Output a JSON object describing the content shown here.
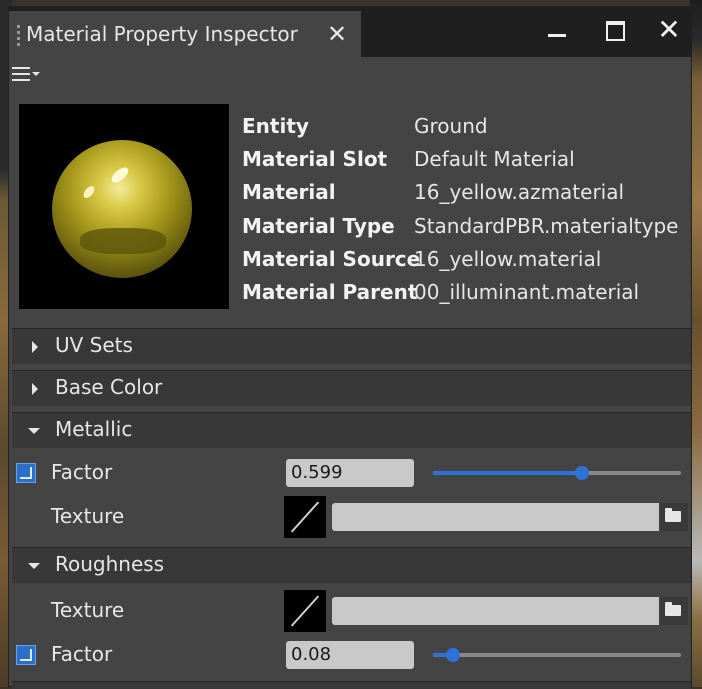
{
  "window": {
    "title": "Material Property Inspector"
  },
  "info": [
    {
      "key": "Entity",
      "value": "Ground"
    },
    {
      "key": "Material Slot",
      "value": "Default Material"
    },
    {
      "key": "Material",
      "value": "16_yellow.azmaterial"
    },
    {
      "key": "Material Type",
      "value": "StandardPBR.materialtype"
    },
    {
      "key": "Material Source",
      "value": "16_yellow.material"
    },
    {
      "key": "Material Parent",
      "value": "00_illuminant.material"
    }
  ],
  "sections": {
    "uv_sets": {
      "label": "UV Sets",
      "expanded": false
    },
    "base_color": {
      "label": "Base Color",
      "expanded": false
    },
    "metallic": {
      "label": "Metallic",
      "expanded": true,
      "factor": {
        "label": "Factor",
        "value": "0.599",
        "slider": 0.599
      },
      "texture": {
        "label": "Texture",
        "path": ""
      }
    },
    "roughness": {
      "label": "Roughness",
      "expanded": true,
      "texture": {
        "label": "Texture",
        "path": ""
      },
      "factor": {
        "label": "Factor",
        "value": "0.08",
        "slider": 0.08
      }
    }
  },
  "colors": {
    "accent": "#2d73d7",
    "panel": "#444444",
    "header": "#383838",
    "titlebar": "#1f1f1f"
  },
  "icons": [
    "grip-icon",
    "close-icon",
    "minimize-icon",
    "maximize-icon",
    "hamburger-menu-icon",
    "chevron-right-icon",
    "chevron-down-icon",
    "override-icon",
    "folder-icon"
  ]
}
